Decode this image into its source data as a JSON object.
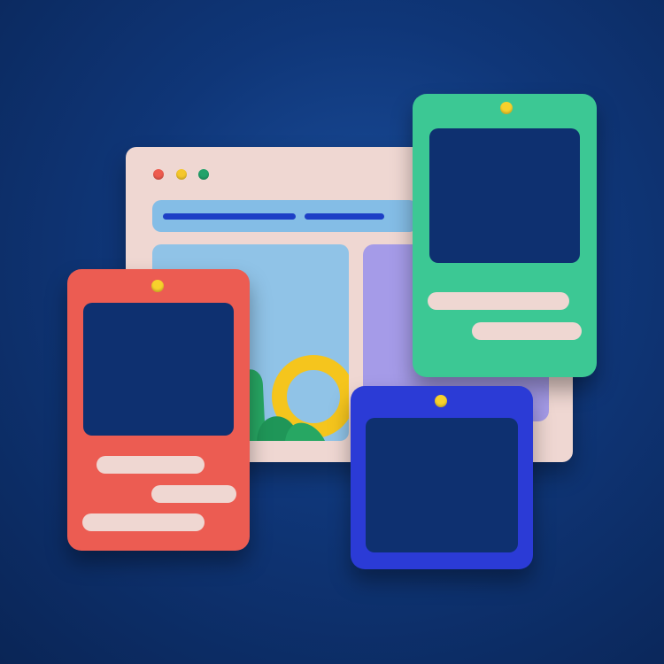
{
  "scene": {
    "background_color": "#0f3678"
  },
  "browser": {
    "colors": {
      "body": "#efd7d2",
      "addressbar": "#84bde6",
      "address_lines": "#1d3fc6",
      "image_card": "#90c3e7",
      "lavender_card": "#a59be8"
    },
    "window_dots": [
      "red",
      "yellow",
      "green"
    ],
    "icons": [
      "sun-ring-icon",
      "hills-icon"
    ]
  },
  "cards": [
    {
      "name": "red-phone-card",
      "color": "#ec5c52",
      "pin": "#f7d12c"
    },
    {
      "name": "green-phone-card",
      "color": "#3cc894",
      "pin": "#f7d12c"
    },
    {
      "name": "blue-frame-card",
      "color": "#2b3bd6",
      "pin": "#f7d12c"
    }
  ]
}
